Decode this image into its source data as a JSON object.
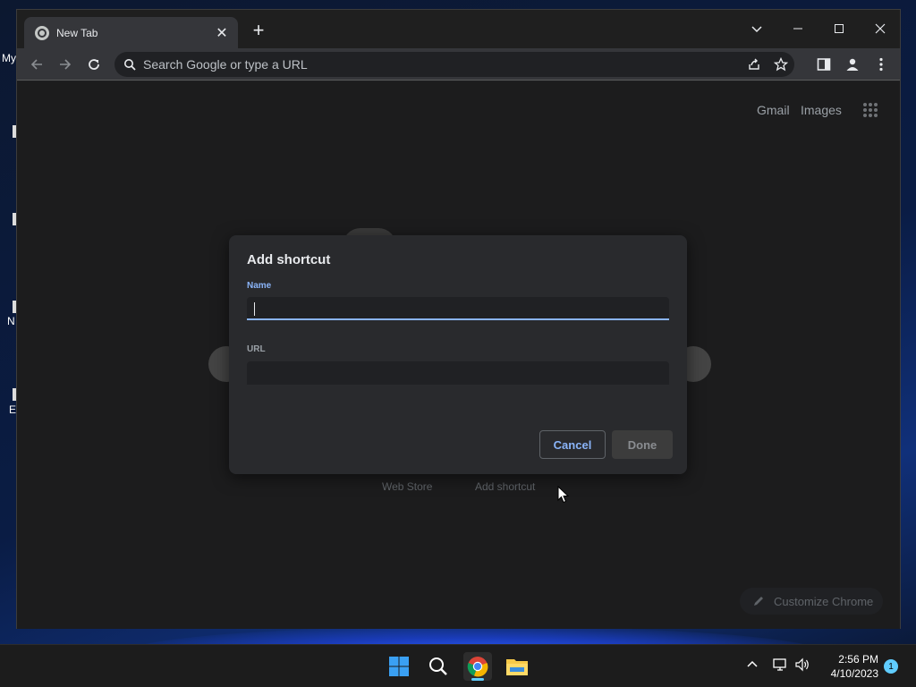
{
  "desktop": {
    "icon_labels": [
      "My",
      "N",
      "E"
    ]
  },
  "browser": {
    "tab": {
      "title": "New Tab",
      "close_glyph": "✕"
    },
    "new_tab_glyph": "+",
    "window_controls": {
      "tabsearch": "⌄",
      "minimize": "—",
      "maximize": "☐",
      "close": "✕"
    },
    "omnibox": {
      "placeholder": "Search Google or type a URL"
    },
    "icons": [
      "back-arrow-icon",
      "forward-arrow-icon",
      "reload-icon",
      "search-icon",
      "share-icon",
      "star-icon",
      "side-panel-icon",
      "profile-icon",
      "kebab-menu-icon"
    ]
  },
  "ntp": {
    "links": {
      "gmail": "Gmail",
      "images": "Images"
    },
    "shortcuts": {
      "web_store": "Web Store",
      "add_shortcut": "Add shortcut"
    },
    "customize_label": "Customize Chrome"
  },
  "dialog": {
    "title": "Add shortcut",
    "name_label": "Name",
    "name_value": "",
    "url_label": "URL",
    "url_value": "",
    "cancel_label": "Cancel",
    "done_label": "Done",
    "accent_color": "#8ab4f8"
  },
  "taskbar": {
    "time": "2:56 PM",
    "date": "4/10/2023",
    "notification_count": "1",
    "chevron_glyph": "^"
  }
}
